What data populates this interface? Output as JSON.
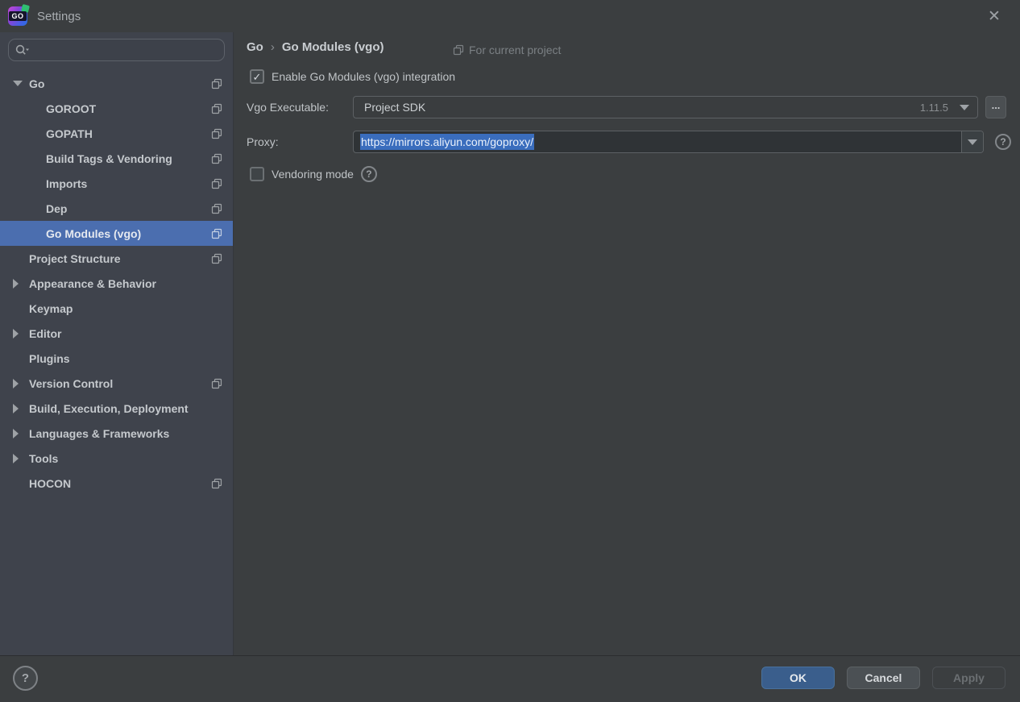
{
  "window": {
    "title": "Settings"
  },
  "icons": {
    "close": "✕",
    "check": "✓",
    "help": "?",
    "browse": "...",
    "breadcrumb_separator": "›"
  },
  "sidebar": {
    "search": {
      "value": "",
      "placeholder": ""
    },
    "items": [
      {
        "label": "Go",
        "level": 0,
        "arrow": "expanded",
        "per_project": true,
        "selected": false
      },
      {
        "label": "GOROOT",
        "level": 1,
        "arrow": "none",
        "per_project": true,
        "selected": false
      },
      {
        "label": "GOPATH",
        "level": 1,
        "arrow": "none",
        "per_project": true,
        "selected": false
      },
      {
        "label": "Build Tags & Vendoring",
        "level": 1,
        "arrow": "none",
        "per_project": true,
        "selected": false
      },
      {
        "label": "Imports",
        "level": 1,
        "arrow": "none",
        "per_project": true,
        "selected": false
      },
      {
        "label": "Dep",
        "level": 1,
        "arrow": "none",
        "per_project": true,
        "selected": false
      },
      {
        "label": "Go Modules (vgo)",
        "level": 1,
        "arrow": "none",
        "per_project": true,
        "selected": true
      },
      {
        "label": "Project Structure",
        "level": 0,
        "arrow": "none",
        "per_project": true,
        "selected": false
      },
      {
        "label": "Appearance & Behavior",
        "level": 0,
        "arrow": "collapsed",
        "per_project": false,
        "selected": false
      },
      {
        "label": "Keymap",
        "level": 0,
        "arrow": "none",
        "per_project": false,
        "selected": false
      },
      {
        "label": "Editor",
        "level": 0,
        "arrow": "collapsed",
        "per_project": false,
        "selected": false
      },
      {
        "label": "Plugins",
        "level": 0,
        "arrow": "none",
        "per_project": false,
        "selected": false
      },
      {
        "label": "Version Control",
        "level": 0,
        "arrow": "collapsed",
        "per_project": true,
        "selected": false
      },
      {
        "label": "Build, Execution, Deployment",
        "level": 0,
        "arrow": "collapsed",
        "per_project": false,
        "selected": false
      },
      {
        "label": "Languages & Frameworks",
        "level": 0,
        "arrow": "collapsed",
        "per_project": false,
        "selected": false
      },
      {
        "label": "Tools",
        "level": 0,
        "arrow": "collapsed",
        "per_project": false,
        "selected": false
      },
      {
        "label": "HOCON",
        "level": 0,
        "arrow": "none",
        "per_project": true,
        "selected": false
      }
    ]
  },
  "main": {
    "breadcrumb": {
      "part1": "Go",
      "part2": "Go Modules (vgo)"
    },
    "scope_label": "For current project",
    "enable_checkbox": {
      "label": "Enable Go Modules (vgo) integration",
      "checked": true
    },
    "vgo_executable": {
      "label": "Vgo Executable:",
      "value": "Project SDK",
      "version": "1.11.5"
    },
    "proxy": {
      "label": "Proxy:",
      "value": "https://mirrors.aliyun.com/goproxy/",
      "text_selected": true
    },
    "vendoring_checkbox": {
      "label": "Vendoring mode",
      "checked": false
    }
  },
  "footer": {
    "buttons": [
      {
        "label": "OK",
        "style": "primary"
      },
      {
        "label": "Cancel",
        "style": "normal"
      },
      {
        "label": "Apply",
        "style": "disabled"
      }
    ]
  },
  "colors": {
    "panel_bg": "#3b3e40",
    "sidebar_bg": "#3f434c",
    "tree_selection": "#4b6eaf",
    "text_selection": "#3a6dbd",
    "primary_button": "#3a5e8c",
    "field_bg": "#2f3336"
  },
  "logo_text": "GO"
}
